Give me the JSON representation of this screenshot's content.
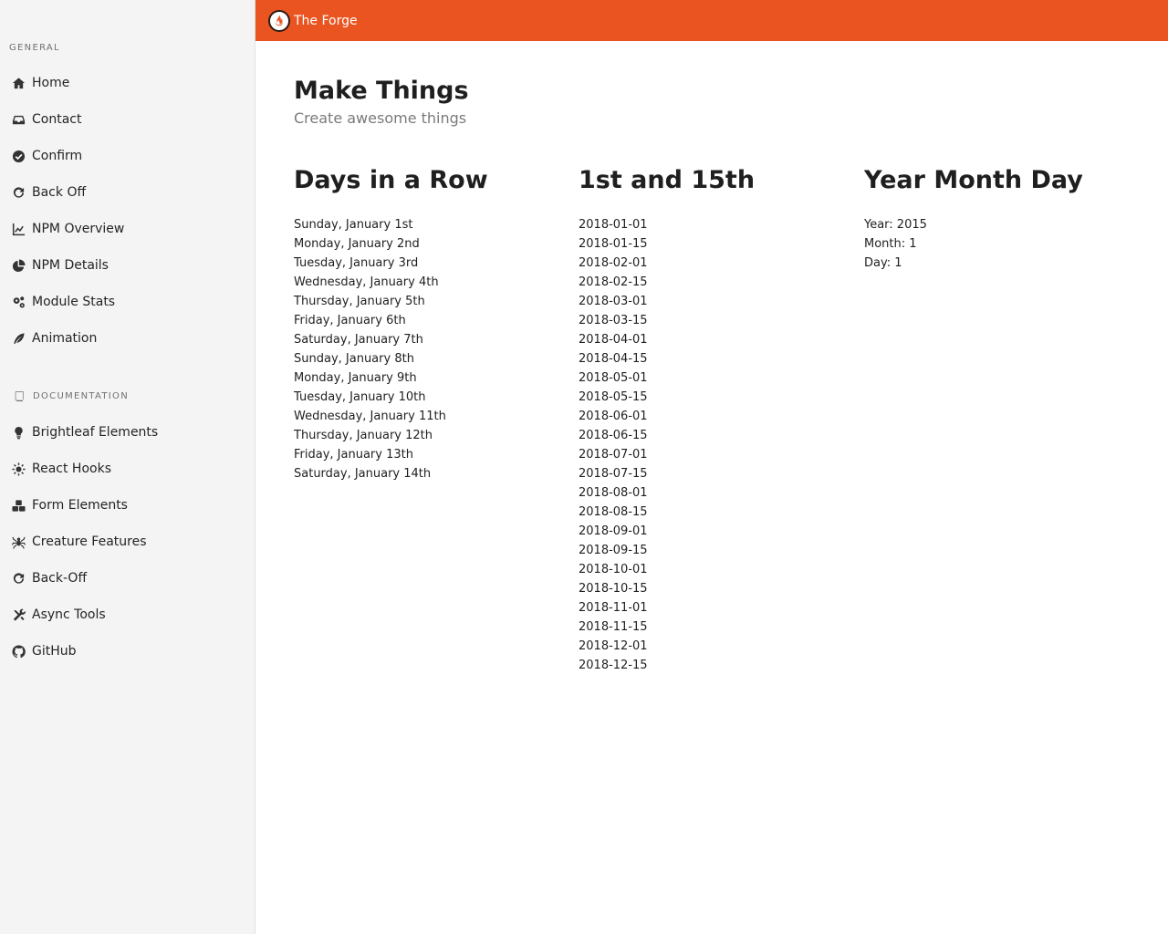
{
  "header": {
    "brand": "The Forge"
  },
  "sidebar": {
    "general_label": "GENERAL",
    "general_items": [
      {
        "label": "Home",
        "icon": "home-icon"
      },
      {
        "label": "Contact",
        "icon": "inbox-icon"
      },
      {
        "label": "Confirm",
        "icon": "check-circle-icon"
      },
      {
        "label": "Back Off",
        "icon": "redo-icon"
      },
      {
        "label": "NPM Overview",
        "icon": "line-chart-icon"
      },
      {
        "label": "NPM Details",
        "icon": "pie-chart-icon"
      },
      {
        "label": "Module Stats",
        "icon": "cogs-icon"
      },
      {
        "label": "Animation",
        "icon": "feather-icon"
      }
    ],
    "docs_label": "DOCUMENTATION",
    "docs_items": [
      {
        "label": "Brightleaf Elements",
        "icon": "lightbulb-icon"
      },
      {
        "label": "React Hooks",
        "icon": "sun-icon"
      },
      {
        "label": "Form Elements",
        "icon": "cubes-icon"
      },
      {
        "label": "Creature Features",
        "icon": "spider-icon"
      },
      {
        "label": "Back-Off",
        "icon": "redo-icon"
      },
      {
        "label": "Async Tools",
        "icon": "tools-icon"
      },
      {
        "label": "GitHub",
        "icon": "github-icon"
      }
    ]
  },
  "page": {
    "title": "Make Things",
    "subtitle": "Create awesome things"
  },
  "columns": {
    "days": {
      "title": "Days in a Row",
      "items": [
        "Sunday, January 1st",
        "Monday, January 2nd",
        "Tuesday, January 3rd",
        "Wednesday, January 4th",
        "Thursday, January 5th",
        "Friday, January 6th",
        "Saturday, January 7th",
        "Sunday, January 8th",
        "Monday, January 9th",
        "Tuesday, January 10th",
        "Wednesday, January 11th",
        "Thursday, January 12th",
        "Friday, January 13th",
        "Saturday, January 14th"
      ]
    },
    "dates": {
      "title": "1st and 15th",
      "items": [
        "2018-01-01",
        "2018-01-15",
        "2018-02-01",
        "2018-02-15",
        "2018-03-01",
        "2018-03-15",
        "2018-04-01",
        "2018-04-15",
        "2018-05-01",
        "2018-05-15",
        "2018-06-01",
        "2018-06-15",
        "2018-07-01",
        "2018-07-15",
        "2018-08-01",
        "2018-08-15",
        "2018-09-01",
        "2018-09-15",
        "2018-10-01",
        "2018-10-15",
        "2018-11-01",
        "2018-11-15",
        "2018-12-01",
        "2018-12-15"
      ]
    },
    "ymd": {
      "title": "Year Month Day",
      "items": [
        "Year: 2015",
        "Month: 1",
        "Day: 1"
      ]
    }
  },
  "colors": {
    "header": "#e95420",
    "sidebar": "#f4f4f4"
  }
}
